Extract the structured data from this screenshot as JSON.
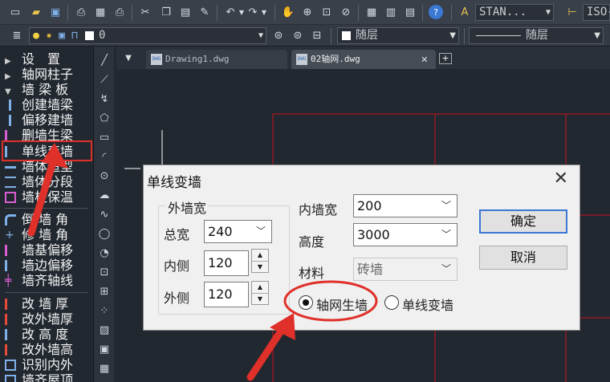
{
  "toolbar": {
    "icons": [
      "new-icon",
      "open-icon",
      "save-icon",
      "plot-icon",
      "plot-preview-icon",
      "publish-icon",
      "cut-icon",
      "copy-icon",
      "paste-icon",
      "match-properties-icon",
      "undo-icon",
      "redo-icon",
      "pan-icon",
      "zoom-realtime-icon",
      "zoom-window-icon",
      "zoom-previous-icon",
      "properties-icon",
      "design-center-icon",
      "tool-palettes-icon",
      "help-icon",
      "text-style-icon",
      "dim-style-icon"
    ],
    "text_style": "STAN...",
    "dim_style": "ISO-"
  },
  "layerbar": {
    "layer_name": "0",
    "color": "随层",
    "linetype": "随层"
  },
  "tabs": [
    {
      "label": "Drawing1.dwg"
    },
    {
      "label": "02轴网.dwg"
    }
  ],
  "menu": [
    {
      "label": "设　置"
    },
    {
      "label": "轴网柱子"
    },
    {
      "label": "墙 梁 板"
    },
    {
      "label": "创建墙梁"
    },
    {
      "label": "偏移建墙"
    },
    {
      "label": "删墙生梁"
    },
    {
      "label": "单线变墙"
    },
    {
      "label": "墙体造型"
    },
    {
      "label": "墙体分段"
    },
    {
      "label": "墙柱保温"
    },
    {
      "label": "倒 墙 角"
    },
    {
      "label": "修 墙 角"
    },
    {
      "label": "墙基偏移"
    },
    {
      "label": "墙边偏移"
    },
    {
      "label": "墙齐轴线"
    },
    {
      "label": "改 墙 厚"
    },
    {
      "label": "改外墙厚"
    },
    {
      "label": "改 高 度"
    },
    {
      "label": "改外墙高"
    },
    {
      "label": "识别内外"
    },
    {
      "label": "墙齐屋顶"
    }
  ],
  "dialog": {
    "title": "单线变墙",
    "outer_group": "外墙宽",
    "total_width_label": "总宽",
    "total_width": "240",
    "inner_side_label": "内侧",
    "inner_side": "120",
    "outer_side_label": "外侧",
    "outer_side": "120",
    "inner_wall_width_label": "内墙宽",
    "inner_wall_width": "200",
    "height_label": "高度",
    "height": "3000",
    "material_label": "材料",
    "material": "砖墙",
    "radio_grid": "轴网生墙",
    "radio_single": "单线变墙",
    "ok": "确定",
    "cancel": "取消"
  },
  "colors": {
    "annotation": "#e0302a",
    "grid_line": "#c8141e",
    "accent": "#3a78d4"
  }
}
